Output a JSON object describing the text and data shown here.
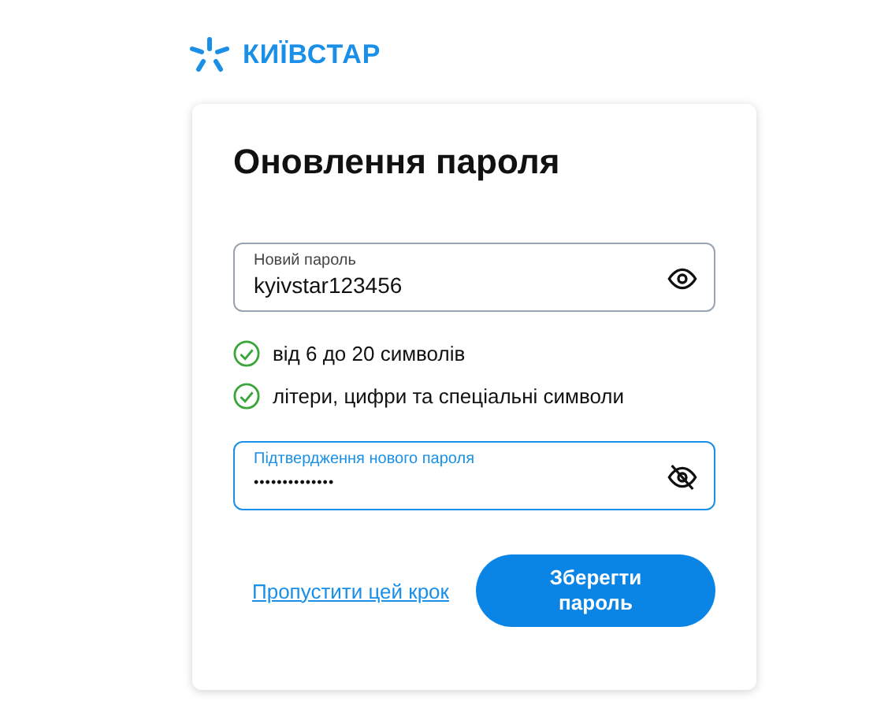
{
  "logo": {
    "text": "КИЇВСТАР"
  },
  "card": {
    "title": "Оновлення пароля",
    "fields": [
      {
        "label": "Новий пароль",
        "value": "kyivstar123456",
        "masked": false,
        "focused": false
      },
      {
        "label": "Підтвердження нового пароля",
        "value": "••••••••••••••",
        "masked": true,
        "focused": true
      }
    ],
    "requirements": [
      {
        "text": "від 6 до 20 символів",
        "met": true
      },
      {
        "text": "літери, цифри та спеціальні символи",
        "met": true
      }
    ],
    "skip_link": "Пропустити цей крок",
    "save_button": "Зберегти пароль"
  }
}
